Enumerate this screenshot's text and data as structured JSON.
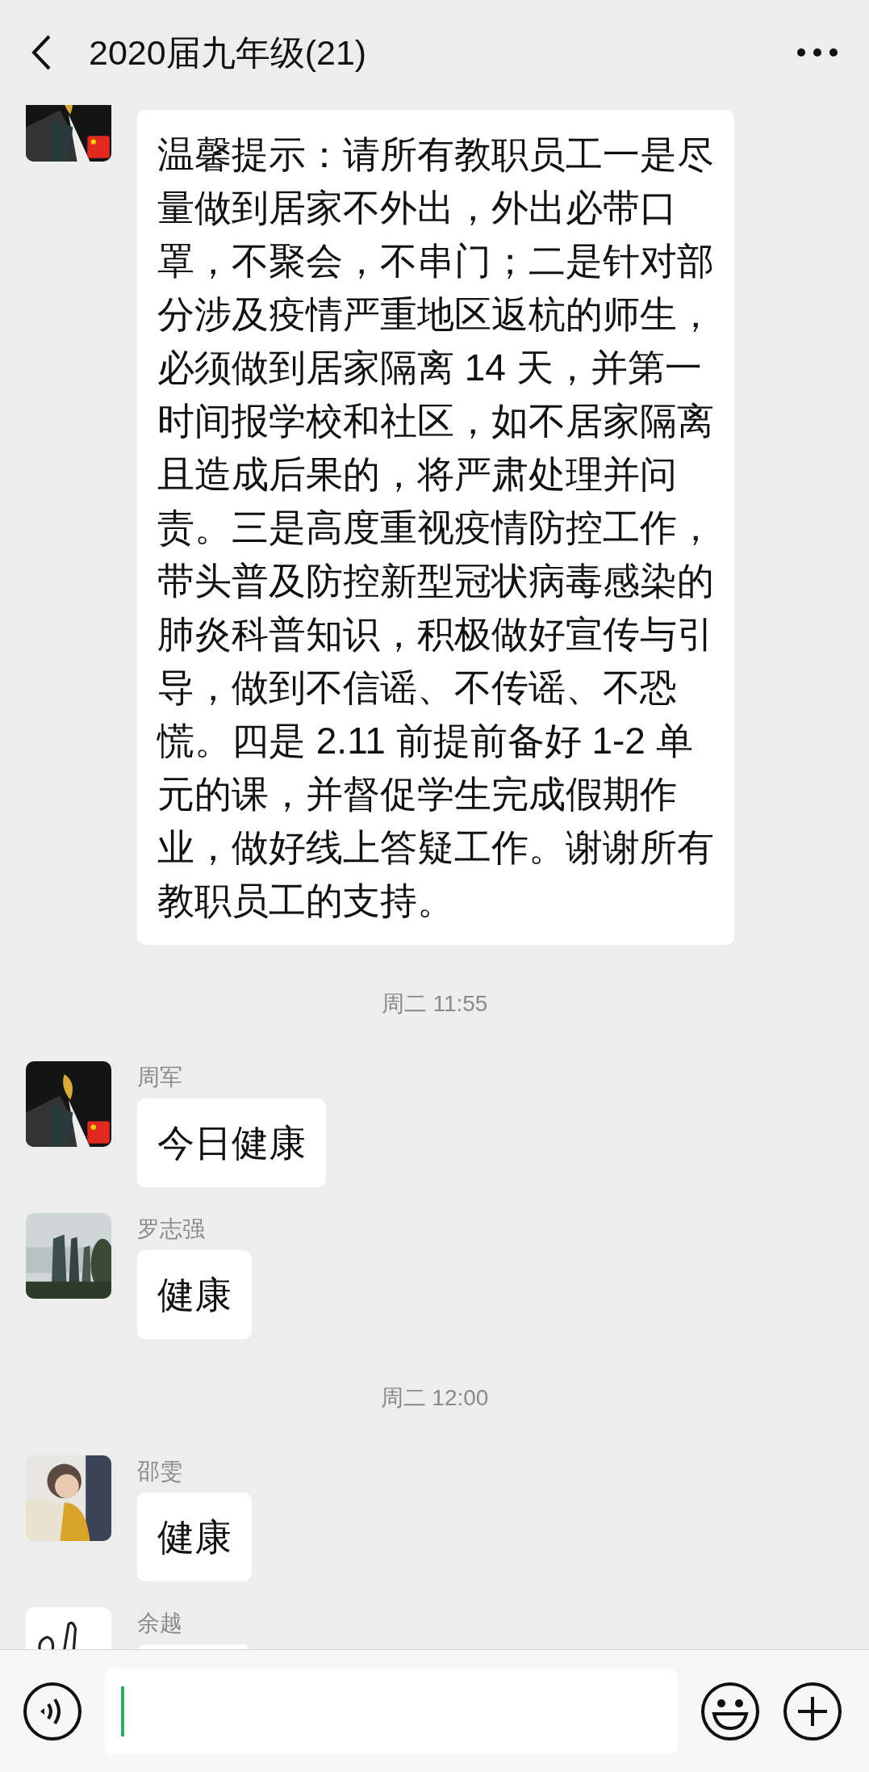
{
  "header": {
    "title": "2020届九年级(21)"
  },
  "messages": [
    {
      "kind": "message",
      "text": "温馨提示：请所有教职员工一是尽量做到居家不外出，外出必带口罩，不聚会，不串门；二是针对部分涉及疫情严重地区返杭的师生，必须做到居家隔离 14 天，并第一时间报学校和社区，如不居家隔离且造成后果的，将严肃处理并问责。三是高度重视疫情防控工作，带头普及防控新型冠状病毒感染的肺炎科普知识，积极做好宣传与引导，做到不信谣、不传谣、不恐慌。四是 2.11 前提前备好 1-2 单元的课，并督促学生完成假期作业，做好线上答疑工作。谢谢所有教职员工的支持。"
    },
    {
      "kind": "time",
      "text": "周二 11:55"
    },
    {
      "kind": "message",
      "sender": "周军",
      "text": "今日健康"
    },
    {
      "kind": "message",
      "sender": "罗志强",
      "text": "健康"
    },
    {
      "kind": "time",
      "text": "周二 12:00"
    },
    {
      "kind": "message",
      "sender": "邵雯",
      "text": "健康"
    },
    {
      "kind": "message",
      "sender": "余越"
    }
  ]
}
